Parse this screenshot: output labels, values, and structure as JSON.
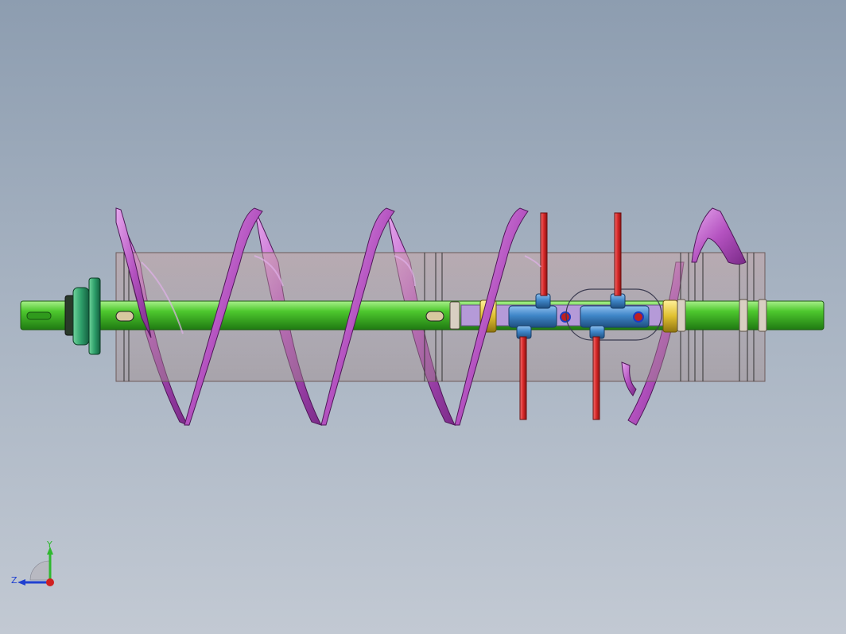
{
  "viewport": {
    "background_top": "#8d9db0",
    "background_bottom": "#c2c9d3"
  },
  "model": {
    "shaft_color": "#4ec82e",
    "flight_color": "#b452c0",
    "barrel_color": "#c09f9f",
    "paddle_color": "#d82828",
    "hub_color": "#3f86c8",
    "collar_color": "#e0c030",
    "bearing_color": "#2e9f6a"
  },
  "triad": {
    "y_label": "Y",
    "z_label": "Z",
    "y_color": "#2fb82f",
    "z_color": "#2040d0",
    "x_color": "#d02020"
  }
}
